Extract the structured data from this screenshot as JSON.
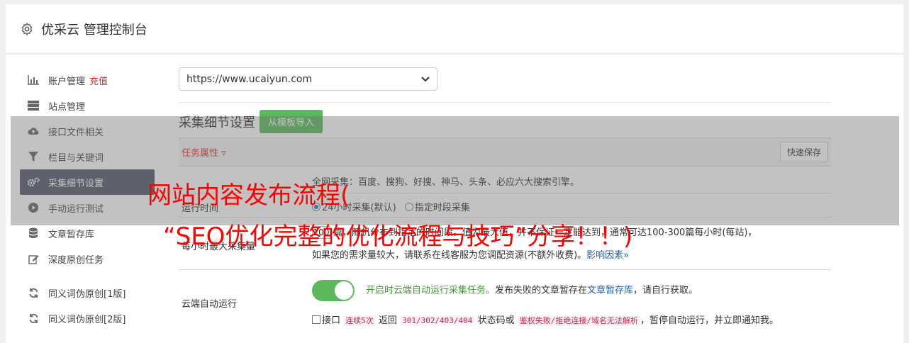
{
  "header": {
    "title": "优采云 管理控制台",
    "icon": "gear-icon"
  },
  "sidebar": {
    "items": [
      {
        "label": "账户管理",
        "tag": "充值",
        "icon": "bar-chart-icon"
      },
      {
        "label": "站点管理",
        "icon": "server-icon"
      },
      {
        "label": "接口文件相关",
        "icon": "cloud-upload-icon"
      },
      {
        "label": "栏目与关键词",
        "icon": "filter-icon"
      },
      {
        "label": "采集细节设置",
        "icon": "cogs-icon",
        "active": true
      },
      {
        "label": "手动运行测试",
        "icon": "play-circle-icon"
      },
      {
        "label": "文章暂存库",
        "icon": "database-icon"
      },
      {
        "label": "深度原创任务",
        "icon": "edit-icon"
      },
      {
        "label": "同义词伪原创[1版]",
        "icon": "refresh-icon"
      },
      {
        "label": "同义词伪原创[2版]",
        "icon": "refresh-icon"
      }
    ]
  },
  "site_select": {
    "value": "https://www.ucaiyun.com"
  },
  "section": {
    "title": "采集细节设置",
    "import_button": "从模板导入"
  },
  "table": {
    "head_attr": "任务属性 ▿",
    "quick_save": "快速保存",
    "row1_text": "全网采集：百度、搜狗、好搜、神马、头条、必应六大搜索引擎。",
    "run_time_label": "运行时间",
    "run_time_opt1": "24小时采集(默认)",
    "run_time_opt2": "指定时段采集",
    "max_label": "每小时最大采集量",
    "max_value": "100",
    "max_text_line1": "篇，随机分布到指定的时间段。值为最大值，并不保证一定能达到，通常可达100-300篇每小时(每站)，",
    "max_text_line2": "如果您的需求量较大，请联系在线客服为您调配资源(不额外收费)。",
    "max_link": "影响因素",
    "cloud_label": "云端自动运行",
    "cloud_green": "开启时云端自动运行采集任务。",
    "cloud_text": "发布失败的文章暂存在",
    "cloud_link": "文章暂存库",
    "cloud_text2": "，请自行获取。",
    "stop_pre": "接口",
    "stop_code1": "连续5次",
    "stop_mid1": "返回",
    "stop_code2": "301/302/403/404",
    "stop_mid2": "状态码或",
    "stop_code3": "鉴权失败/拒绝连接/域名无法解析",
    "stop_post": "，暂停自动运行，并立即通知我。"
  },
  "watermark": {
    "line1": "网站内容发布流程(",
    "line2": "“SEO优化完整的优化流程与技巧”分享！！)"
  },
  "colors": {
    "active_bg": "#50596b",
    "green": "#5cb85c",
    "red": "#d9302a",
    "link": "#1d5fb0"
  }
}
